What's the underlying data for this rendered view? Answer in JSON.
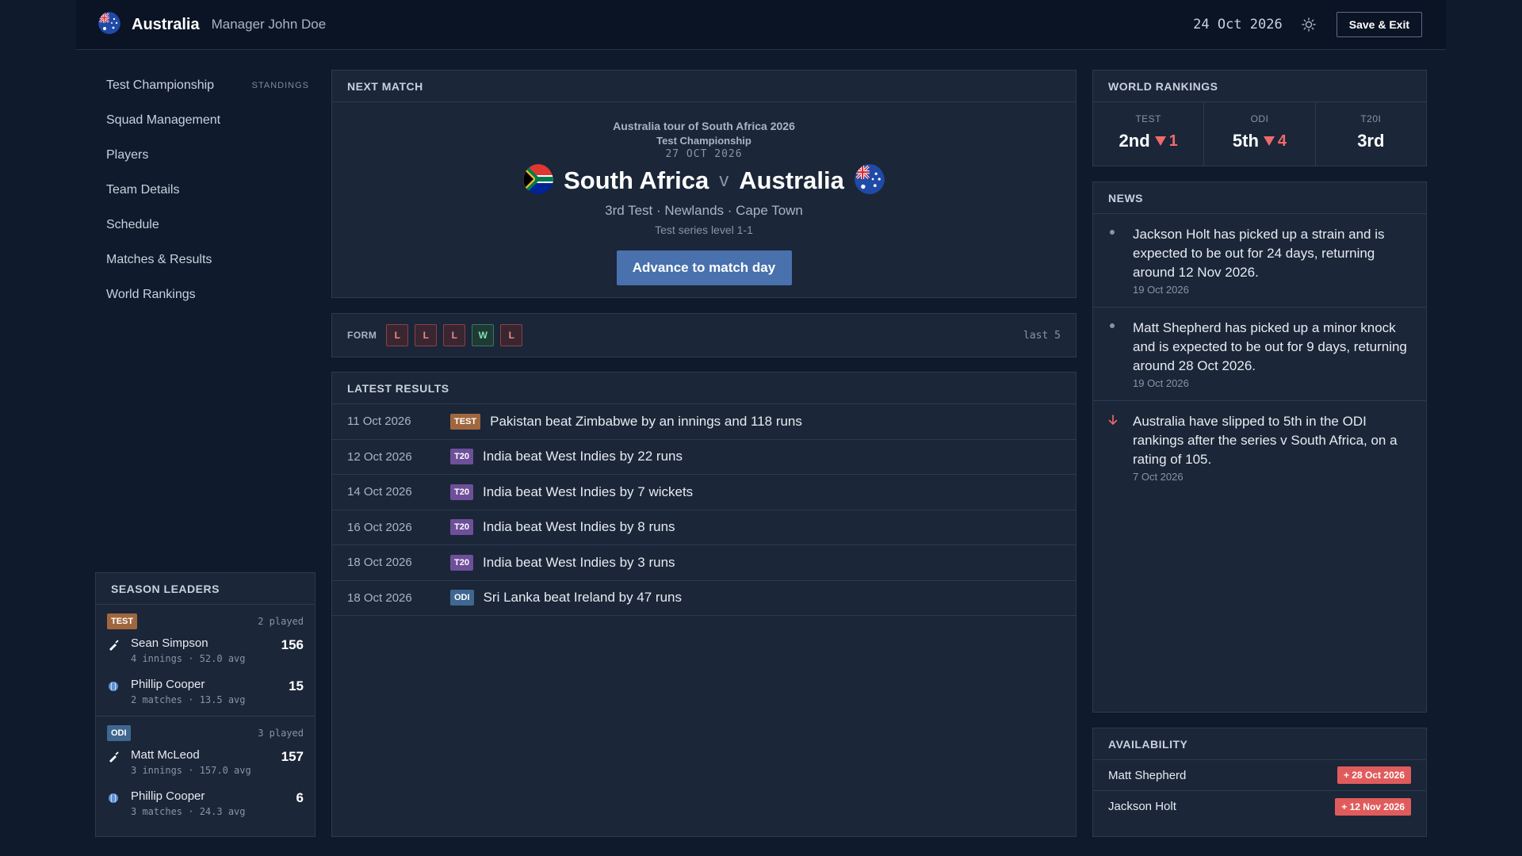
{
  "header": {
    "team": "Australia",
    "manager": "Manager John Doe",
    "date": "24 Oct 2026",
    "save_label": "Save & Exit"
  },
  "sidebar": {
    "items": [
      {
        "label": "Test Championship",
        "extra": "STANDINGS"
      },
      {
        "label": "Squad Management"
      },
      {
        "label": "Players"
      },
      {
        "label": "Team Details"
      },
      {
        "label": "Schedule"
      },
      {
        "label": "Matches & Results"
      },
      {
        "label": "World Rankings"
      }
    ]
  },
  "next_match": {
    "title": "NEXT MATCH",
    "tour": "Australia tour of South Africa 2026",
    "competition": "Test Championship",
    "date": "27 OCT 2026",
    "home": "South Africa",
    "vs": "v",
    "away": "Australia",
    "venue": "3rd Test · Newlands · Cape Town",
    "series": "Test series level 1-1",
    "advance_label": "Advance to match day"
  },
  "form": {
    "label": "FORM",
    "results": [
      "L",
      "L",
      "L",
      "W",
      "L"
    ],
    "last_label": "last 5"
  },
  "latest_results": {
    "title": "LATEST RESULTS",
    "rows": [
      {
        "date": "11 Oct 2026",
        "format": "TEST",
        "text": "Pakistan beat Zimbabwe by an innings and 118 runs"
      },
      {
        "date": "12 Oct 2026",
        "format": "T20",
        "text": "India beat West Indies by 22 runs"
      },
      {
        "date": "14 Oct 2026",
        "format": "T20",
        "text": "India beat West Indies by 7 wickets"
      },
      {
        "date": "16 Oct 2026",
        "format": "T20",
        "text": "India beat West Indies by 8 runs"
      },
      {
        "date": "18 Oct 2026",
        "format": "T20",
        "text": "India beat West Indies by 3 runs"
      },
      {
        "date": "18 Oct 2026",
        "format": "ODI",
        "text": "Sri Lanka beat Ireland by 47 runs"
      }
    ]
  },
  "season_leaders": {
    "title": "SEASON LEADERS",
    "sections": [
      {
        "format": "TEST",
        "played": "2 played",
        "players": [
          {
            "icon": "bat-icon",
            "name": "Sean Simpson",
            "sub": "4 innings · 52.0 avg",
            "value": "156"
          },
          {
            "icon": "ball-icon",
            "name": "Phillip Cooper",
            "sub": "2 matches · 13.5 avg",
            "value": "15"
          }
        ]
      },
      {
        "format": "ODI",
        "played": "3 played",
        "players": [
          {
            "icon": "bat-icon",
            "name": "Matt McLeod",
            "sub": "3 innings · 157.0 avg",
            "value": "157"
          },
          {
            "icon": "ball-icon",
            "name": "Phillip Cooper",
            "sub": "3 matches · 24.3 avg",
            "value": "6"
          }
        ]
      }
    ]
  },
  "world_rankings": {
    "title": "WORLD RANKINGS",
    "items": [
      {
        "label": "TEST",
        "value": "2nd",
        "change": "1"
      },
      {
        "label": "ODI",
        "value": "5th",
        "change": "4"
      },
      {
        "label": "T20I",
        "value": "3rd",
        "change": ""
      }
    ],
    "change_color": "#f06a6a"
  },
  "news": {
    "title": "NEWS",
    "items": [
      {
        "icon": "dot-icon",
        "text": "Jackson Holt has picked up a strain and is expected to be out for 24 days, returning around 12 Nov 2026.",
        "date": "19 Oct 2026"
      },
      {
        "icon": "dot-icon",
        "text": "Matt Shepherd has picked up a minor knock and is expected to be out for 9 days, returning around 28 Oct 2026.",
        "date": "19 Oct 2026"
      },
      {
        "icon": "arrow-down-icon",
        "text": "Australia have slipped to 5th in the ODI rankings after the series v South Africa, on a rating of 105.",
        "date": "7 Oct 2026"
      }
    ]
  },
  "availability": {
    "title": "AVAILABILITY",
    "rows": [
      {
        "name": "Matt Shepherd",
        "badge": "+ 28 Oct 2026"
      },
      {
        "name": "Jackson Holt",
        "badge": "+ 12 Nov 2026"
      }
    ]
  },
  "colors": {
    "background": "#0f1a2c",
    "panel": "#1b2638",
    "accent": "#4871ad",
    "loss": "#f08a8a",
    "win": "#7fe0b5",
    "injury": "#e05c5c",
    "test": "#a0673e",
    "t20": "#6e4f99",
    "odi": "#3f6790"
  }
}
